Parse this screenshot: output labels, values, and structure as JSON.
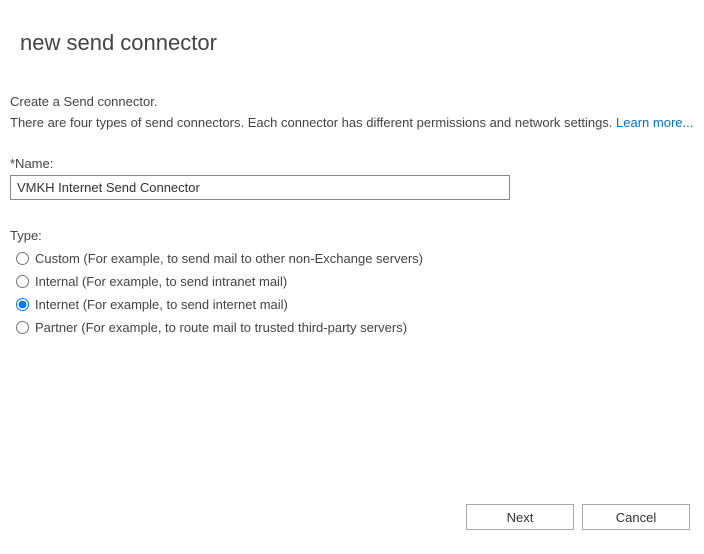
{
  "title": "new send connector",
  "intro": "Create a Send connector.",
  "description_part1": "There are four types of send connectors. Each connector has different permissions and network settings. ",
  "learn_more_label": "Learn more...",
  "name_field": {
    "label": "*Name:",
    "value": "VMKH Internet Send Connector"
  },
  "type_field": {
    "label": "Type:",
    "options": [
      {
        "label": "Custom (For example, to send mail to other non-Exchange servers)",
        "selected": false
      },
      {
        "label": "Internal (For example, to send intranet mail)",
        "selected": false
      },
      {
        "label": "Internet (For example, to send internet mail)",
        "selected": true
      },
      {
        "label": "Partner (For example, to route mail to trusted third-party servers)",
        "selected": false
      }
    ]
  },
  "buttons": {
    "next": "Next",
    "cancel": "Cancel"
  }
}
